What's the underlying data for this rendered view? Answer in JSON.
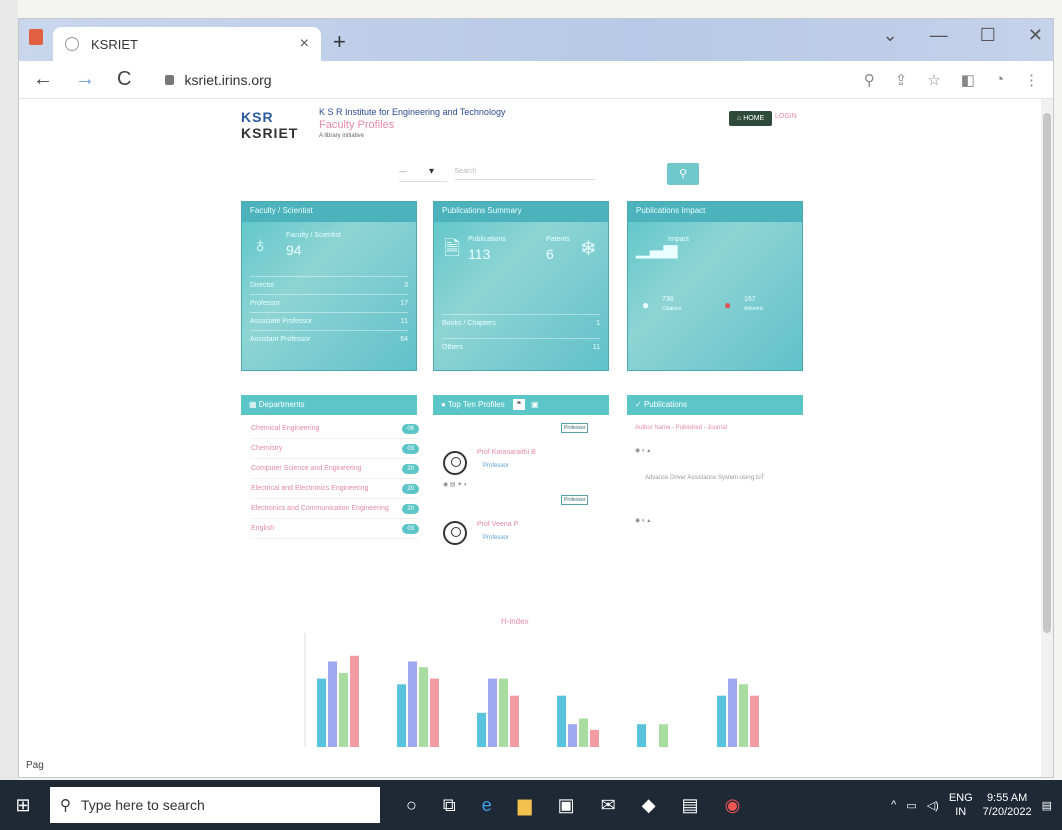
{
  "browser": {
    "tab_title": "KSRIET",
    "tab_close": "×",
    "new_tab": "+",
    "url": "ksriet.irins.org",
    "back": "←",
    "forward": "→",
    "reload": "C"
  },
  "header": {
    "logo_top": "KSR",
    "logo_bottom": "KSRIET",
    "institution": "K S R Institute for Engineering and Technology",
    "subtitle": "Faculty Profiles",
    "tagline": "A library initiative",
    "home_button": "HOME",
    "login": "LOGIN"
  },
  "search": {
    "select_value": "---",
    "placeholder": "Search"
  },
  "cards": {
    "faculty": {
      "title": "Faculty / Scientist",
      "label": "Faculty / Scientist",
      "count": "94",
      "rows": [
        {
          "label": "Director",
          "value": "3"
        },
        {
          "label": "Professor",
          "value": "17"
        },
        {
          "label": "Associate Professor",
          "value": "11"
        },
        {
          "label": "Assistant Professor",
          "value": "64"
        }
      ]
    },
    "publications": {
      "title": "Publications Summary",
      "label": "Publications",
      "count": "113",
      "patents_label": "Patents",
      "patents": "6",
      "rows": [
        {
          "label": "Books / Chapters",
          "value": "1"
        },
        {
          "label": "Others",
          "value": "11"
        }
      ]
    },
    "impact": {
      "title": "Publications Impact",
      "label": "Impact",
      "citations": "736",
      "citations_label": "Citations",
      "altmetric": "167",
      "altmetric_label": "Altmetric"
    }
  },
  "departments": {
    "title": "Departments",
    "items": [
      {
        "name": "Chemical Engineering",
        "count": "06"
      },
      {
        "name": "Chemistry",
        "count": "03"
      },
      {
        "name": "Computer Science and Engineering",
        "count": "20"
      },
      {
        "name": "Electrical and Electronics Engineering",
        "count": "20"
      },
      {
        "name": "Electronics and Communication Engineering",
        "count": "20"
      },
      {
        "name": "English",
        "count": "03"
      }
    ]
  },
  "top_profiles": {
    "title": "Top Ten Profiles",
    "profiles": [
      {
        "name": "Prof Karasaraithi B",
        "role": "Professor",
        "tag": "Professor"
      },
      {
        "name": "Prof Veena P",
        "role": "Professor",
        "tag": "Professor"
      }
    ]
  },
  "pub_panel": {
    "title": "Publications",
    "lines": [
      "Author Name - Published - Journal",
      "Advance Driver Assistance System using IoT"
    ]
  },
  "chart_data": {
    "type": "bar",
    "title": "H-index",
    "ylim": [
      0,
      20
    ],
    "series": [
      {
        "values": [
          12,
          11,
          6,
          9,
          4,
          9
        ],
        "color": "#58c4dc"
      },
      {
        "values": [
          15,
          15,
          12,
          4,
          0,
          12
        ],
        "color": "#9ea8ee"
      },
      {
        "values": [
          13,
          14,
          12,
          5,
          4,
          11
        ],
        "color": "#a8dca0"
      },
      {
        "values": [
          16,
          12,
          9,
          3,
          0,
          9
        ],
        "color": "#f49aa2"
      }
    ]
  },
  "taskbar": {
    "search_placeholder": "Type here to search",
    "lang": "ENG",
    "region": "IN",
    "time": "9:55 AM",
    "date": "7/20/2022"
  },
  "misc": {
    "left_label": "Pag"
  }
}
